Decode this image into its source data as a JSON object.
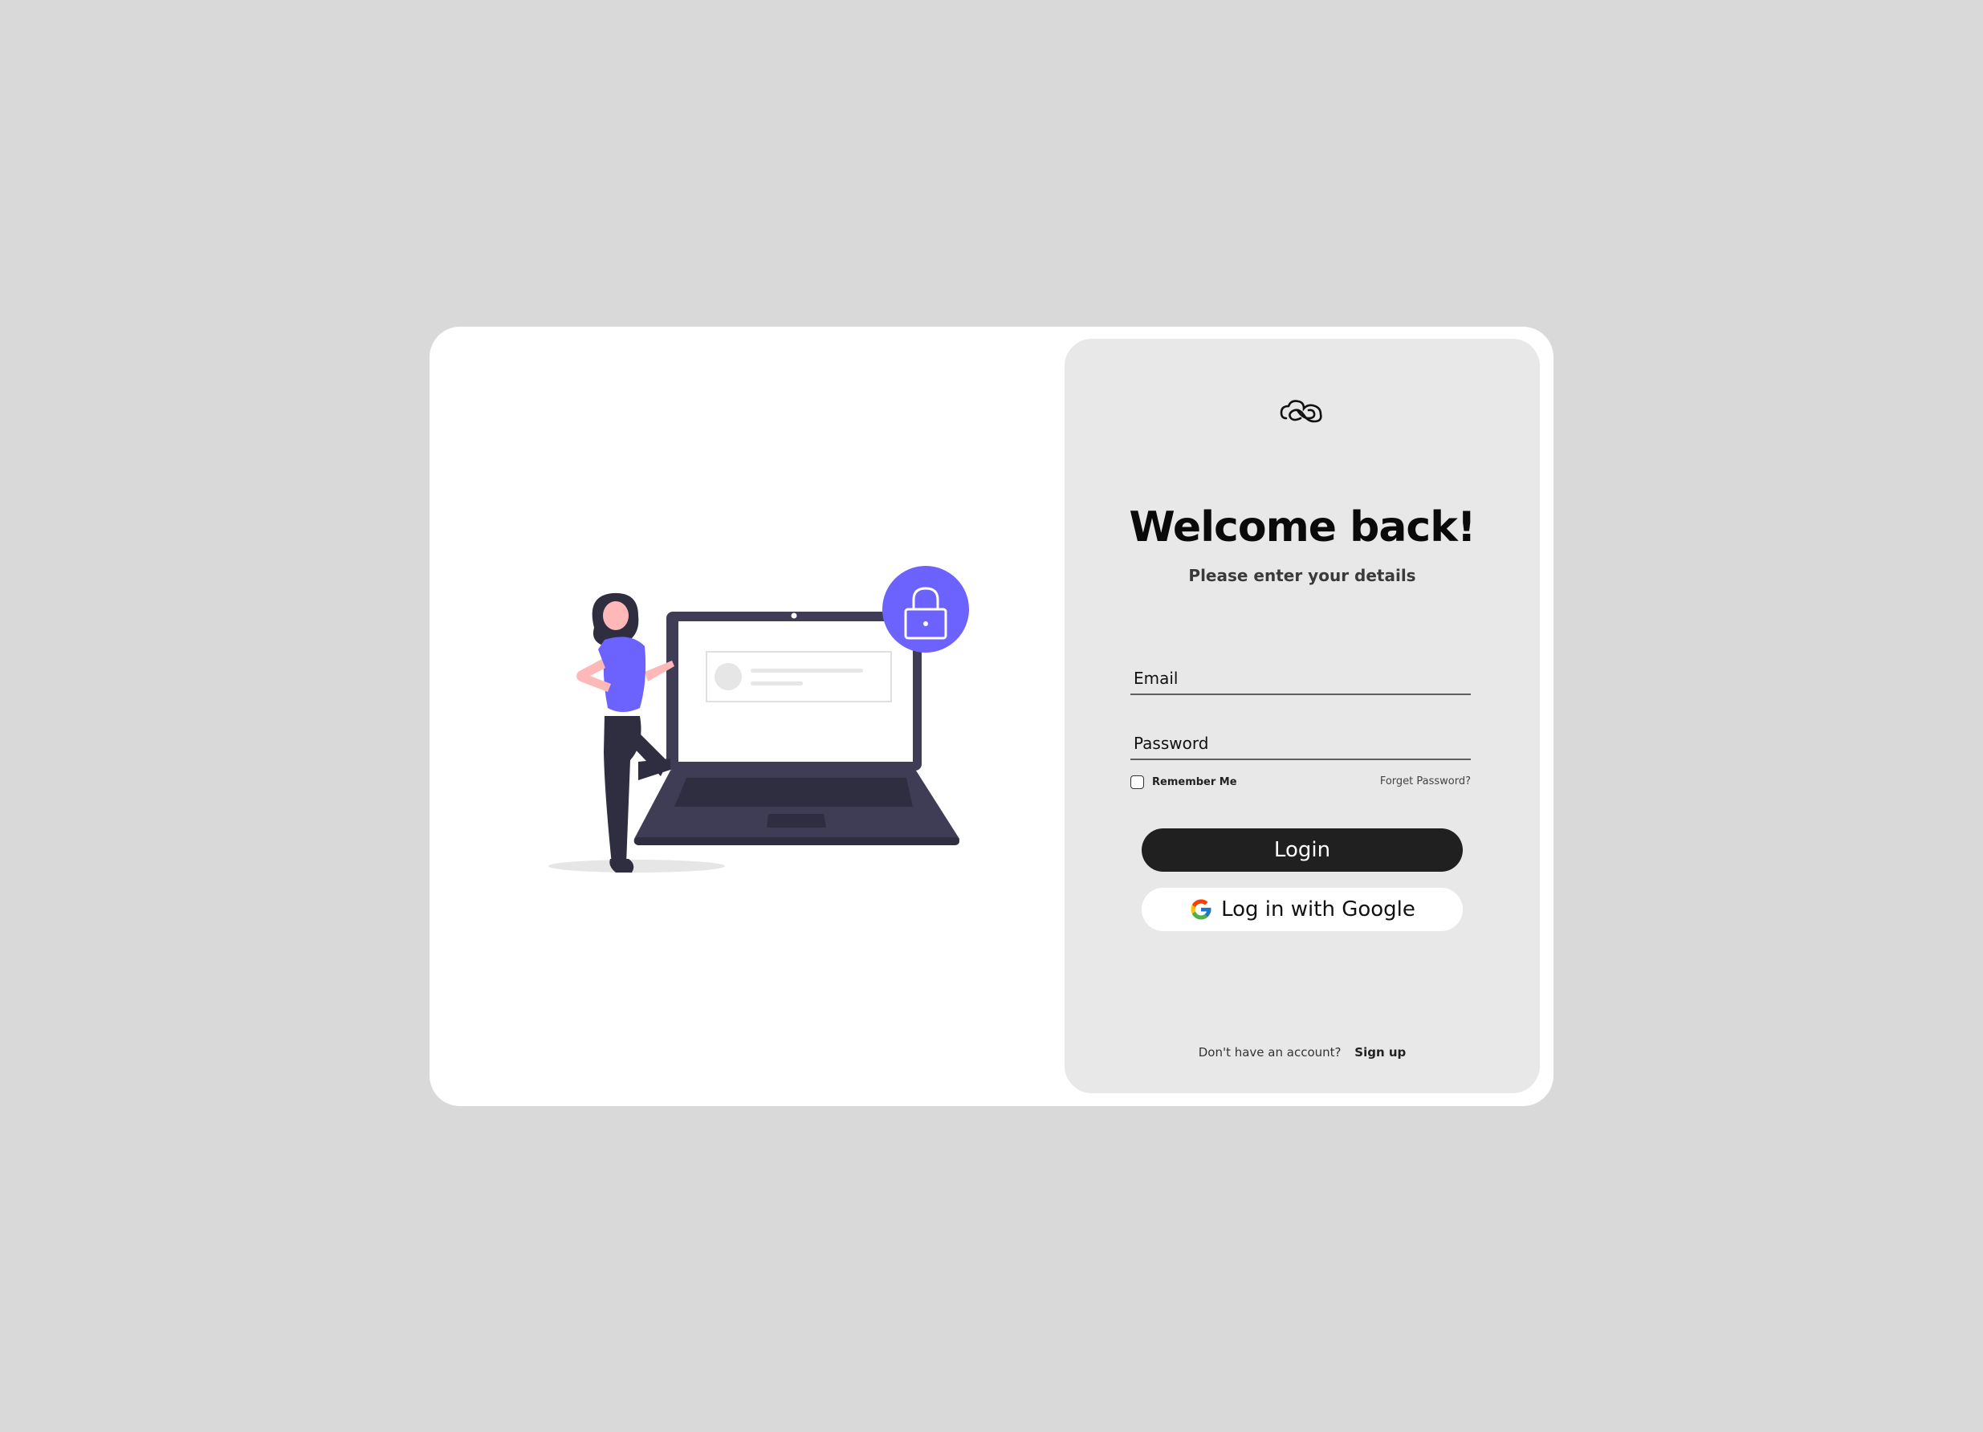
{
  "login": {
    "title": "Welcome back!",
    "subtitle": "Please enter your details",
    "email_placeholder": "Email",
    "password_placeholder": "Password",
    "remember_label": "Remember Me",
    "forgot_label": "Forget Password?",
    "login_button": "Login",
    "google_button": "Log in with Google",
    "no_account_text": "Don't have an account?",
    "signup_link": "Sign up"
  },
  "icons": {
    "logo": "cloud-infinity-logo",
    "lock": "lock-icon",
    "google": "google-icon",
    "illustration": "woman-leaning-on-laptop-illustration"
  },
  "colors": {
    "background": "#d9d9d9",
    "card": "#ffffff",
    "panel": "#e8e8e8",
    "accent": "#6c63ff",
    "button_dark": "#202020",
    "laptop": "#3f3d56"
  }
}
